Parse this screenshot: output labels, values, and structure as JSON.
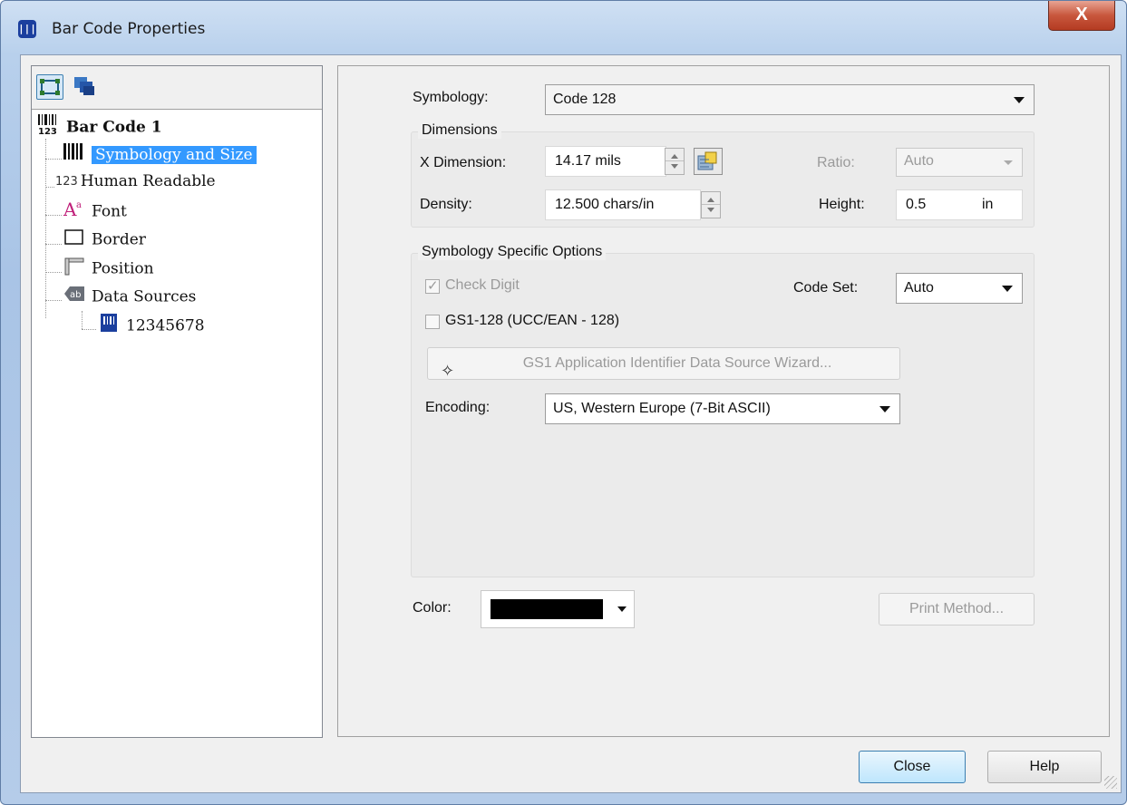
{
  "window": {
    "title": "Bar Code Properties",
    "close_glyph": "X"
  },
  "tree": {
    "root": "Bar Code 1",
    "items": [
      {
        "label": "Symbology and Size",
        "icon": "barcode-icon",
        "selected": true
      },
      {
        "label": "Human Readable",
        "icon": "human-readable-123-icon",
        "prefix": "123"
      },
      {
        "label": "Font",
        "icon": "font-icon"
      },
      {
        "label": "Border",
        "icon": "border-icon"
      },
      {
        "label": "Position",
        "icon": "position-ruler-icon"
      },
      {
        "label": "Data Sources",
        "icon": "data-sources-icon"
      }
    ],
    "data_source_child": "12345678"
  },
  "form": {
    "symbology_label": "Symbology:",
    "symbology_value": "Code 128",
    "dimensions_title": "Dimensions",
    "x_dimension_label": "X Dimension:",
    "x_dimension_value": "14.17  mils",
    "ratio_label": "Ratio:",
    "ratio_value": "Auto",
    "density_label": "Density:",
    "density_value": "12.500  chars/in",
    "height_label": "Height:",
    "height_value": "0.5",
    "height_unit": "in",
    "specific_title": "Symbology Specific Options",
    "check_digit_label": "Check Digit",
    "code_set_label": "Code Set:",
    "code_set_value": "Auto",
    "gs1_label": "GS1-128 (UCC/EAN - 128)",
    "wizard_label": "GS1 Application Identifier Data Source Wizard...",
    "encoding_label": "Encoding:",
    "encoding_value": "US, Western Europe (7-Bit ASCII)",
    "color_label": "Color:",
    "color_value": "#000000",
    "print_method_label": "Print Method..."
  },
  "footer": {
    "close_label": "Close",
    "help_label": "Help"
  },
  "colors": {
    "selection": "#3399ff",
    "title_bar": "#b8d0ec",
    "close_button": "#c8573d"
  }
}
